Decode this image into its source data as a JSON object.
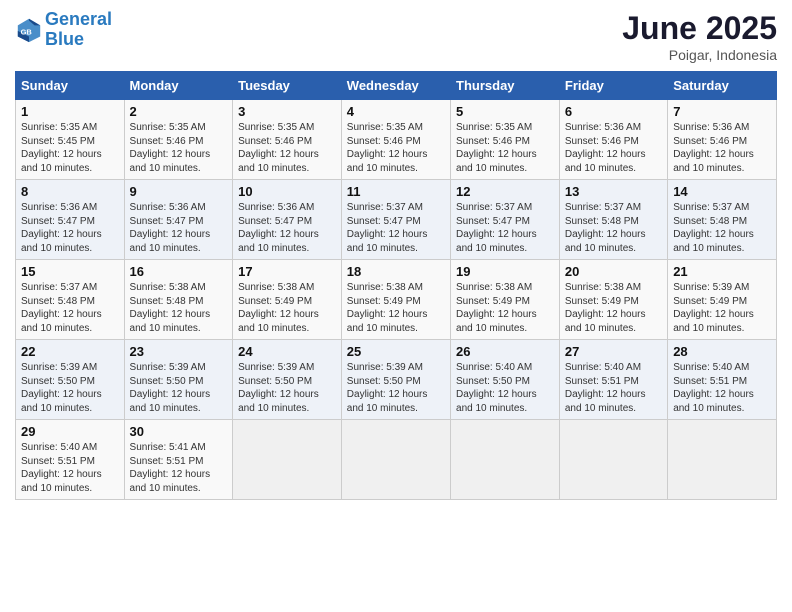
{
  "header": {
    "logo_line1": "General",
    "logo_line2": "Blue",
    "month": "June 2025",
    "location": "Poigar, Indonesia"
  },
  "weekdays": [
    "Sunday",
    "Monday",
    "Tuesday",
    "Wednesday",
    "Thursday",
    "Friday",
    "Saturday"
  ],
  "weeks": [
    [
      {
        "day": "1",
        "info": "Sunrise: 5:35 AM\nSunset: 5:45 PM\nDaylight: 12 hours\nand 10 minutes."
      },
      {
        "day": "2",
        "info": "Sunrise: 5:35 AM\nSunset: 5:46 PM\nDaylight: 12 hours\nand 10 minutes."
      },
      {
        "day": "3",
        "info": "Sunrise: 5:35 AM\nSunset: 5:46 PM\nDaylight: 12 hours\nand 10 minutes."
      },
      {
        "day": "4",
        "info": "Sunrise: 5:35 AM\nSunset: 5:46 PM\nDaylight: 12 hours\nand 10 minutes."
      },
      {
        "day": "5",
        "info": "Sunrise: 5:35 AM\nSunset: 5:46 PM\nDaylight: 12 hours\nand 10 minutes."
      },
      {
        "day": "6",
        "info": "Sunrise: 5:36 AM\nSunset: 5:46 PM\nDaylight: 12 hours\nand 10 minutes."
      },
      {
        "day": "7",
        "info": "Sunrise: 5:36 AM\nSunset: 5:46 PM\nDaylight: 12 hours\nand 10 minutes."
      }
    ],
    [
      {
        "day": "8",
        "info": "Sunrise: 5:36 AM\nSunset: 5:47 PM\nDaylight: 12 hours\nand 10 minutes."
      },
      {
        "day": "9",
        "info": "Sunrise: 5:36 AM\nSunset: 5:47 PM\nDaylight: 12 hours\nand 10 minutes."
      },
      {
        "day": "10",
        "info": "Sunrise: 5:36 AM\nSunset: 5:47 PM\nDaylight: 12 hours\nand 10 minutes."
      },
      {
        "day": "11",
        "info": "Sunrise: 5:37 AM\nSunset: 5:47 PM\nDaylight: 12 hours\nand 10 minutes."
      },
      {
        "day": "12",
        "info": "Sunrise: 5:37 AM\nSunset: 5:47 PM\nDaylight: 12 hours\nand 10 minutes."
      },
      {
        "day": "13",
        "info": "Sunrise: 5:37 AM\nSunset: 5:48 PM\nDaylight: 12 hours\nand 10 minutes."
      },
      {
        "day": "14",
        "info": "Sunrise: 5:37 AM\nSunset: 5:48 PM\nDaylight: 12 hours\nand 10 minutes."
      }
    ],
    [
      {
        "day": "15",
        "info": "Sunrise: 5:37 AM\nSunset: 5:48 PM\nDaylight: 12 hours\nand 10 minutes."
      },
      {
        "day": "16",
        "info": "Sunrise: 5:38 AM\nSunset: 5:48 PM\nDaylight: 12 hours\nand 10 minutes."
      },
      {
        "day": "17",
        "info": "Sunrise: 5:38 AM\nSunset: 5:49 PM\nDaylight: 12 hours\nand 10 minutes."
      },
      {
        "day": "18",
        "info": "Sunrise: 5:38 AM\nSunset: 5:49 PM\nDaylight: 12 hours\nand 10 minutes."
      },
      {
        "day": "19",
        "info": "Sunrise: 5:38 AM\nSunset: 5:49 PM\nDaylight: 12 hours\nand 10 minutes."
      },
      {
        "day": "20",
        "info": "Sunrise: 5:38 AM\nSunset: 5:49 PM\nDaylight: 12 hours\nand 10 minutes."
      },
      {
        "day": "21",
        "info": "Sunrise: 5:39 AM\nSunset: 5:49 PM\nDaylight: 12 hours\nand 10 minutes."
      }
    ],
    [
      {
        "day": "22",
        "info": "Sunrise: 5:39 AM\nSunset: 5:50 PM\nDaylight: 12 hours\nand 10 minutes."
      },
      {
        "day": "23",
        "info": "Sunrise: 5:39 AM\nSunset: 5:50 PM\nDaylight: 12 hours\nand 10 minutes."
      },
      {
        "day": "24",
        "info": "Sunrise: 5:39 AM\nSunset: 5:50 PM\nDaylight: 12 hours\nand 10 minutes."
      },
      {
        "day": "25",
        "info": "Sunrise: 5:39 AM\nSunset: 5:50 PM\nDaylight: 12 hours\nand 10 minutes."
      },
      {
        "day": "26",
        "info": "Sunrise: 5:40 AM\nSunset: 5:50 PM\nDaylight: 12 hours\nand 10 minutes."
      },
      {
        "day": "27",
        "info": "Sunrise: 5:40 AM\nSunset: 5:51 PM\nDaylight: 12 hours\nand 10 minutes."
      },
      {
        "day": "28",
        "info": "Sunrise: 5:40 AM\nSunset: 5:51 PM\nDaylight: 12 hours\nand 10 minutes."
      }
    ],
    [
      {
        "day": "29",
        "info": "Sunrise: 5:40 AM\nSunset: 5:51 PM\nDaylight: 12 hours\nand 10 minutes."
      },
      {
        "day": "30",
        "info": "Sunrise: 5:41 AM\nSunset: 5:51 PM\nDaylight: 12 hours\nand 10 minutes."
      },
      {
        "day": "",
        "info": ""
      },
      {
        "day": "",
        "info": ""
      },
      {
        "day": "",
        "info": ""
      },
      {
        "day": "",
        "info": ""
      },
      {
        "day": "",
        "info": ""
      }
    ]
  ]
}
